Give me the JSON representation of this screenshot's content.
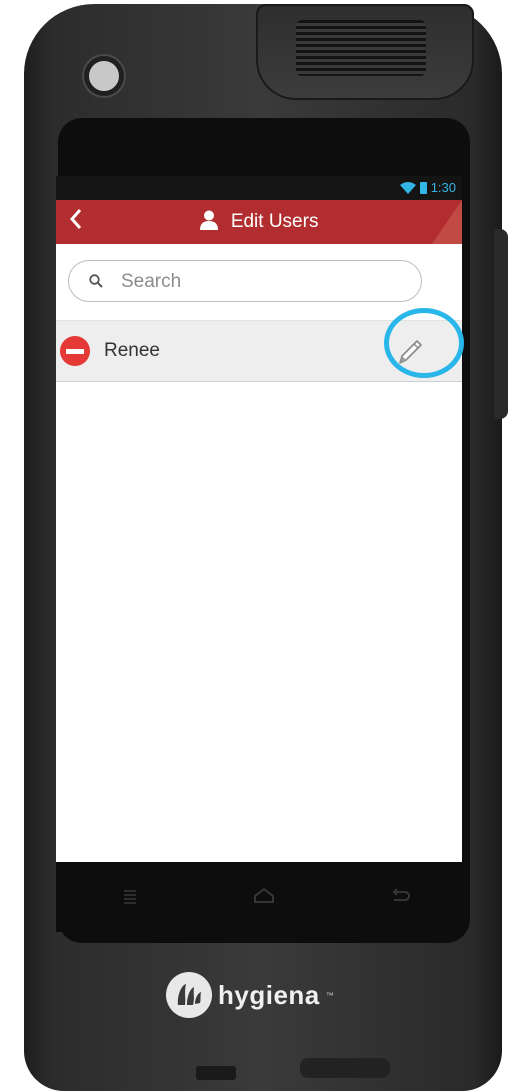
{
  "status_bar": {
    "time": "1:30"
  },
  "header": {
    "title": "Edit Users",
    "back_icon": "chevron-left-icon",
    "user_icon": "person-icon"
  },
  "search": {
    "placeholder": "Search",
    "value": ""
  },
  "users": [
    {
      "name": "Renee"
    }
  ],
  "nav": {
    "icons": [
      "menu-icon",
      "home-icon",
      "back-icon"
    ]
  },
  "brand": {
    "name": "hygiena",
    "tm": "™"
  },
  "colors": {
    "header": "#b12d2f",
    "accent": "#33b5e5",
    "remove": "#e53935",
    "highlight": "#29b6e8"
  }
}
